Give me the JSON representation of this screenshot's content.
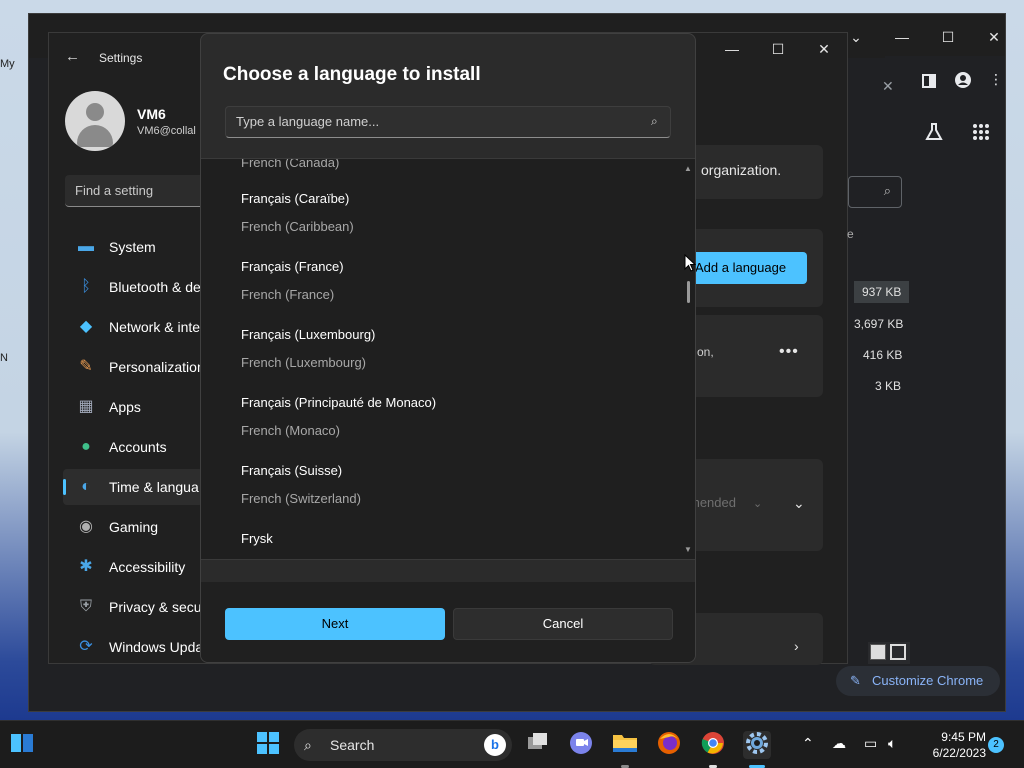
{
  "desktop": {
    "labels": [
      "My",
      "N"
    ]
  },
  "chrome": {
    "customize_label": "Customize Chrome",
    "window_controls": {
      "minimize": "—",
      "maximize": "☐",
      "close": "✕",
      "caret": "⌄"
    },
    "downloads": {
      "sizes": [
        "937 KB",
        "3,697 KB",
        "416 KB",
        "3 KB"
      ]
    },
    "icons": [
      "sidebar-icon",
      "profile-icon",
      "more-icon",
      "labs-icon",
      "apps-grid-icon"
    ]
  },
  "settings": {
    "title": "Settings",
    "user": {
      "name": "VM6",
      "email": "VM6@collal"
    },
    "search_placeholder": "Find a setting",
    "nav": [
      {
        "label": "System",
        "icon": "system-icon"
      },
      {
        "label": "Bluetooth & de",
        "icon": "bluetooth-icon"
      },
      {
        "label": "Network & inte",
        "icon": "network-icon"
      },
      {
        "label": "Personalization",
        "icon": "personalization-icon"
      },
      {
        "label": "Apps",
        "icon": "apps-icon"
      },
      {
        "label": "Accounts",
        "icon": "accounts-icon"
      },
      {
        "label": "Time & langua",
        "icon": "time-language-icon"
      },
      {
        "label": "Gaming",
        "icon": "gaming-icon"
      },
      {
        "label": "Accessibility",
        "icon": "accessibility-icon"
      },
      {
        "label": "Privacy & secu",
        "icon": "privacy-icon"
      },
      {
        "label": "Windows Upda",
        "icon": "windows-update-icon"
      }
    ],
    "content": {
      "org_text": "organization.",
      "add_language": "Add a language",
      "partial_text": "on,",
      "recommended": "mended",
      "partial_e": "e"
    }
  },
  "dialog": {
    "title": "Choose a language to install",
    "search_placeholder": "Type a language name...",
    "partial_top": "French (Canada)",
    "languages": [
      {
        "native": "Français (Caraïbe)",
        "english": "French (Caribbean)"
      },
      {
        "native": "Français (France)",
        "english": "French (France)"
      },
      {
        "native": "Français (Luxembourg)",
        "english": "French (Luxembourg)"
      },
      {
        "native": "Français (Principauté de Monaco)",
        "english": "French (Monaco)"
      },
      {
        "native": "Français (Suisse)",
        "english": "French (Switzerland)"
      }
    ],
    "partial_bottom": "Frysk",
    "next_label": "Next",
    "cancel_label": "Cancel"
  },
  "taskbar": {
    "search_label": "Search",
    "time": "9:45 PM",
    "date": "6/22/2023",
    "notification_count": "2"
  }
}
